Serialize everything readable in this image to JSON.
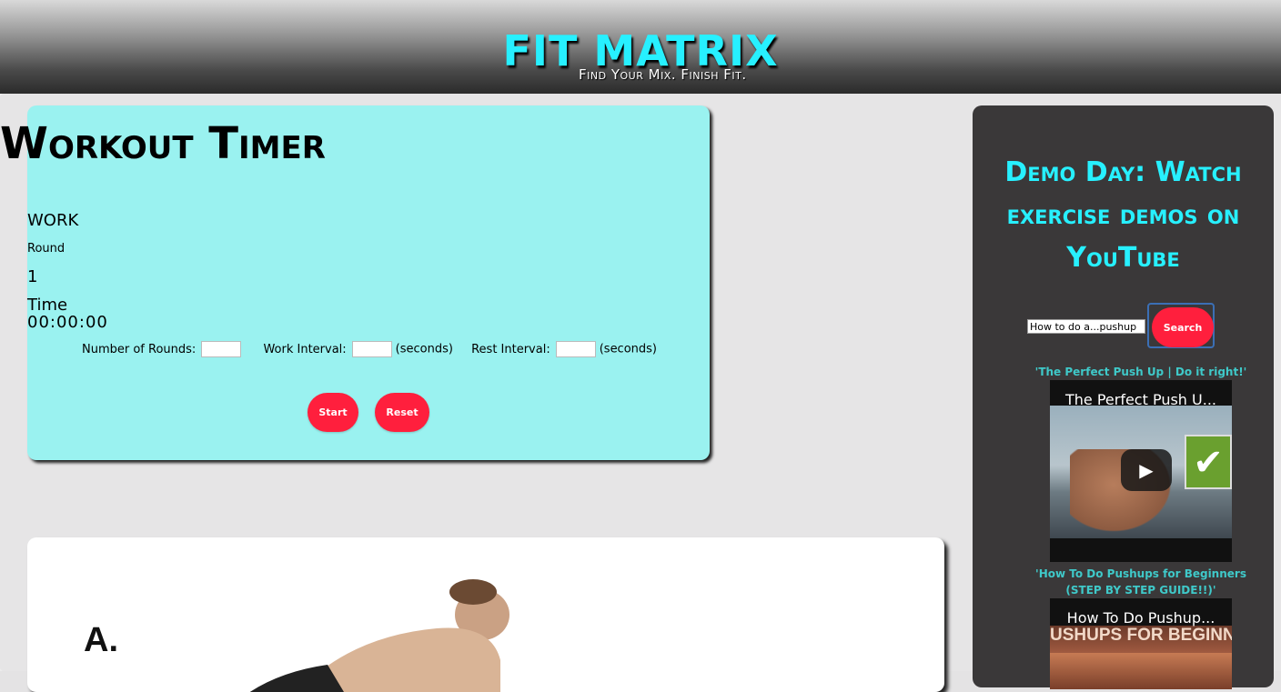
{
  "header": {
    "brand": "FIT MATRIX",
    "tagline": "Find Your Mix. Finish Fit."
  },
  "timer": {
    "title": "Workout Timer",
    "phase": "WORK",
    "round_label": "Round",
    "round_value": "1",
    "time_label": "Time",
    "time_value": "00:00:00",
    "rounds_label": "Number of Rounds:",
    "work_label": "Work Interval:",
    "work_unit": "(seconds)",
    "rest_label": "Rest Interval:",
    "rest_unit": "(seconds)",
    "rounds_value": "",
    "work_value": "",
    "rest_value": "",
    "start_label": "Start",
    "reset_label": "Reset"
  },
  "exercise": {
    "step_label": "A."
  },
  "sidebar": {
    "title": "Demo Day: Watch exercise demos on YouTube",
    "search_value": "How to do a...pushup",
    "search_label": "Search",
    "videos": [
      {
        "title": "'The Perfect Push Up | Do it right!'",
        "thumb_caption": "The Perfect Push U...",
        "play_icon": "play-icon"
      },
      {
        "title": "'How To Do Pushups for Beginners (STEP BY STEP GUIDE!!)'",
        "thumb_caption": "How To Do Pushup...",
        "banner": "USHUPS FOR BEGINNER"
      }
    ]
  },
  "colors": {
    "accent_cyan": "#27f0ff",
    "timer_bg": "#9af2f0",
    "button_red": "#ff1f3d",
    "sidebar_bg": "#3a3839",
    "video_title": "#3fc9c9"
  }
}
